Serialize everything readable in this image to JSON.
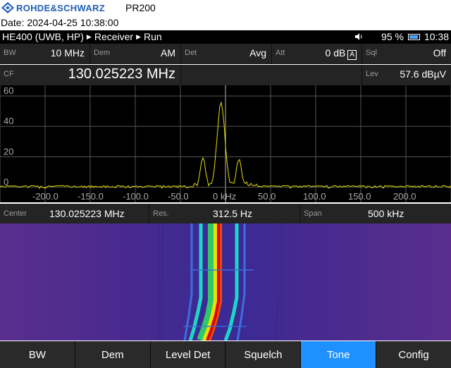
{
  "report": {
    "brand": "ROHDE&SCHWARZ",
    "model": "PR200",
    "date": "Date: 2024-04-25 10:38:00"
  },
  "status": {
    "path": [
      "HE400 (UWB, HP)",
      "Receiver",
      "Run"
    ],
    "battery": "95 %",
    "time": "10:38"
  },
  "params": {
    "bw": {
      "label": "BW",
      "value": "10 MHz"
    },
    "dem": {
      "label": "Dem",
      "value": "AM"
    },
    "det": {
      "label": "Det",
      "value": "Avg"
    },
    "att": {
      "label": "Att",
      "value": "0 dB",
      "badge": "A"
    },
    "sql": {
      "label": "Sql",
      "value": "Off"
    },
    "cf": {
      "label": "CF",
      "value": "130.025223 MHz"
    },
    "lev": {
      "label": "Lev",
      "value": "57.6 dBµV"
    }
  },
  "info": {
    "center": {
      "label": "Center",
      "value": "130.025223 MHz"
    },
    "res": {
      "label": "Res.",
      "value": "312.5 Hz"
    },
    "span": {
      "label": "Span",
      "value": "500 kHz"
    }
  },
  "softkeys": [
    {
      "label": "BW",
      "active": false
    },
    {
      "label": "Dem",
      "active": false
    },
    {
      "label": "Level Det",
      "active": false
    },
    {
      "label": "Squelch",
      "active": false
    },
    {
      "label": "Tone",
      "active": true
    },
    {
      "label": "Config",
      "active": false
    }
  ],
  "colors": {
    "trace": "#e8e000",
    "active_softkey": "#1e90ff",
    "brand": "#1f5fb7"
  },
  "chart_data": {
    "type": "line",
    "y_ticks": [
      "60",
      "40",
      "20",
      "0"
    ],
    "x_ticks": [
      "-200.0",
      "-150.0",
      "-100.0",
      "-50.0",
      "0 kHz",
      "50.0",
      "100.0",
      "150.0",
      "200.0"
    ],
    "xlim": [
      -250,
      250
    ],
    "ylim": [
      -10,
      67
    ],
    "peaks": [
      {
        "x": -25,
        "y": 19
      },
      {
        "x": -5,
        "y": 56
      },
      {
        "x": 15,
        "y": 19
      }
    ],
    "noise_floor": -7
  }
}
